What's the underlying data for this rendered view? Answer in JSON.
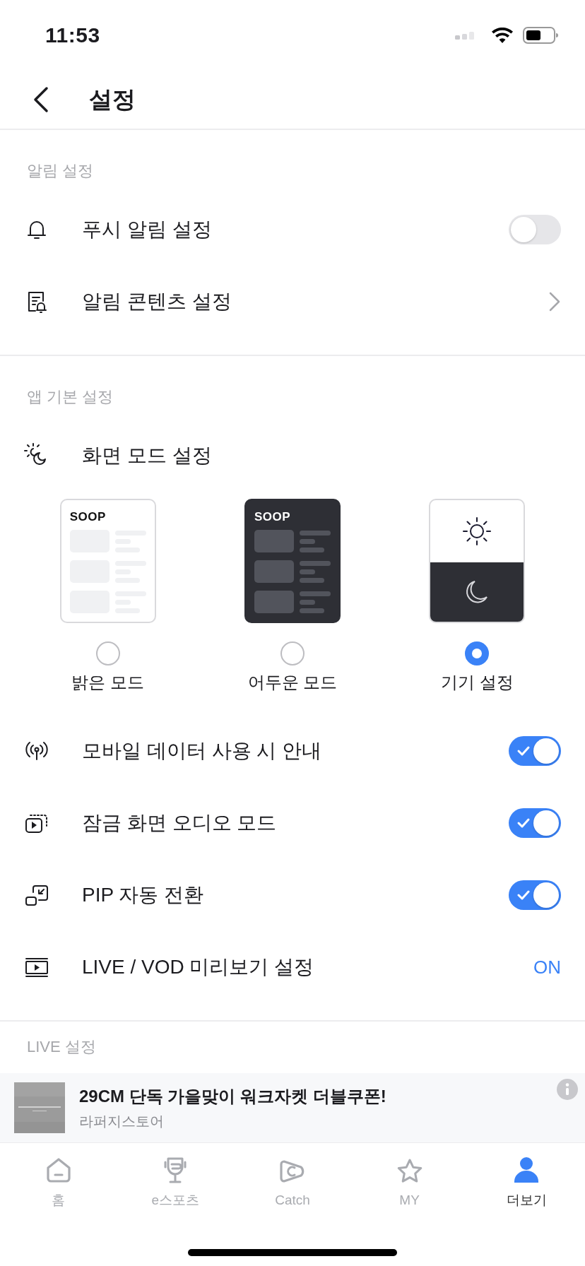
{
  "status_bar": {
    "time": "11:53"
  },
  "header": {
    "title": "설정"
  },
  "sections": [
    {
      "title": "알림 설정",
      "items": [
        {
          "kind": "toggle",
          "label": "푸시 알림 설정",
          "on": false
        },
        {
          "kind": "link",
          "label": "알림 콘텐츠 설정"
        }
      ]
    },
    {
      "title": "앱 기본 설정",
      "items": [
        {
          "kind": "theme",
          "label": "화면 모드 설정",
          "options": [
            {
              "kind": "light",
              "logo": "SOOP",
              "label": "밝은 모드",
              "selected": false
            },
            {
              "kind": "dark",
              "logo": "SOOP",
              "label": "어두운 모드",
              "selected": false
            },
            {
              "kind": "system",
              "label": "기기 설정",
              "selected": true
            }
          ]
        },
        {
          "kind": "toggle",
          "label": "모바일 데이터 사용 시 안내",
          "on": true
        },
        {
          "kind": "toggle",
          "label": "잠금 화면 오디오 모드",
          "on": true
        },
        {
          "kind": "toggle",
          "label": "PIP 자동 전환",
          "on": true
        },
        {
          "kind": "value",
          "label": "LIVE / VOD 미리보기 설정",
          "value": "ON"
        }
      ]
    },
    {
      "title": "LIVE 설정"
    }
  ],
  "ad": {
    "title": "29CM 단독 가을맞이 워크자켓 더블쿠폰!",
    "advertiser": "라퍼지스토어"
  },
  "tabs": [
    {
      "label": "홈",
      "selected": false
    },
    {
      "label": "e스포츠",
      "selected": false
    },
    {
      "label": "Catch",
      "selected": false
    },
    {
      "label": "MY",
      "selected": false
    },
    {
      "label": "더보기",
      "selected": true
    }
  ]
}
